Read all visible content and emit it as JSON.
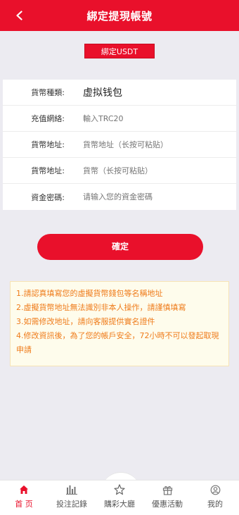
{
  "header": {
    "title": "綁定提現帳號"
  },
  "tag": {
    "label": "綁定USDT"
  },
  "form": {
    "rows": [
      {
        "label": "貨幣種類:",
        "value": "虚拟钱包"
      },
      {
        "label": "充值網絡:",
        "placeholder": "輸入TRC20"
      },
      {
        "label": "貨幣地址:",
        "placeholder": "貨幣地址（长按可粘贴）"
      },
      {
        "label": "貨幣地址:",
        "placeholder": "貨幣（长按可粘贴）"
      },
      {
        "label": "資金密碼:",
        "placeholder": "请输入您的資金密碼"
      }
    ]
  },
  "confirm": {
    "label": "確定"
  },
  "notice": {
    "lines": [
      "1.請認真填寫您的虛擬貨幣錢包等名稱地址",
      "2.虛擬貨幣地址無法識別非本人操作，請謹慎填寫",
      "3.如需修改地址，請向客服提供實名證件",
      "4.修改資訊後，為了您的帳戶安全，72小時不可以發起取現申請"
    ]
  },
  "tabbar": {
    "tabs": [
      {
        "label": "首 页",
        "icon": "home-icon",
        "active": true
      },
      {
        "label": "投注記錄",
        "icon": "bar-chart-icon",
        "active": false
      },
      {
        "label": "購彩大廳",
        "icon": "star-icon",
        "active": false
      },
      {
        "label": "優惠活動",
        "icon": "gift-icon",
        "active": false
      },
      {
        "label": "我的",
        "icon": "user-icon",
        "active": false
      }
    ]
  },
  "colors": {
    "brand": "#e9102b",
    "notice_text": "#ef7b1a",
    "notice_bg": "#fefcec"
  }
}
